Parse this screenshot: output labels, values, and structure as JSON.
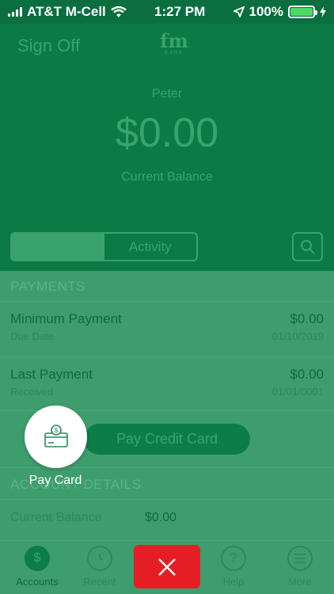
{
  "status_bar": {
    "carrier": "AT&T M-Cell",
    "time": "1:27 PM",
    "battery": "100%"
  },
  "header": {
    "sign_off": "Sign Off",
    "logo_text": "fm",
    "logo_sub": "BANK",
    "user_name": "Peter",
    "balance": "$0.00",
    "balance_label": "Current Balance",
    "segments": [
      "",
      "Activity"
    ]
  },
  "payments": {
    "title": "PAYMENTS",
    "rows": [
      {
        "title": "Minimum Payment",
        "sub": "Due Date",
        "amount": "$0.00",
        "date": "01/10/2019"
      },
      {
        "title": "Last Payment",
        "sub": "Received",
        "amount": "$0.00",
        "date": "01/01/0001"
      }
    ],
    "pay_button": "Pay Credit Card"
  },
  "account_details": {
    "title": "ACCOUNT DETAILS",
    "rows": [
      {
        "label": "Current Balance",
        "value": "$0.00"
      }
    ]
  },
  "fab": {
    "label": "Pay Card"
  },
  "tab_bar": {
    "items": [
      {
        "label": "Accounts"
      },
      {
        "label": "Recent"
      },
      {
        "label": "Help"
      },
      {
        "label": "More"
      }
    ]
  },
  "colors": {
    "header_green": "#0b7a45",
    "content_green": "#3e9d6d",
    "close_red": "#e51e25"
  }
}
